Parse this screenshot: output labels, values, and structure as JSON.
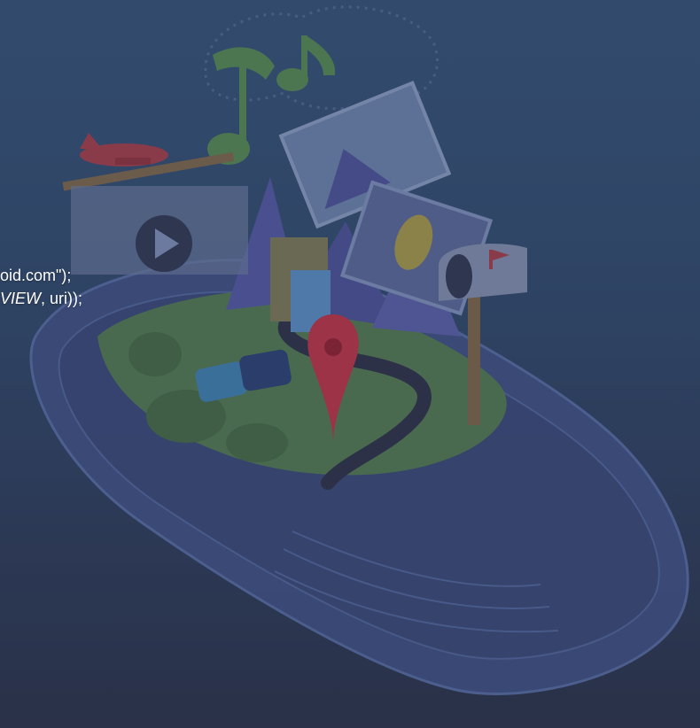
{
  "code": {
    "line1": {
      "text": "oid.com\");"
    },
    "line2": {
      "italic": "VIEW",
      "rest": ", uri));"
    }
  },
  "illustration": {
    "subject": "phone-with-city-scene",
    "icons": [
      "play-icon",
      "music-note-icon",
      "airplane-icon",
      "map-pin-icon",
      "mailbox-icon",
      "photo-icon"
    ]
  },
  "colors": {
    "background_top": "#324b6d",
    "background_bottom": "#2a3148",
    "overlay": "#2f4566",
    "text": "#ffffff"
  }
}
